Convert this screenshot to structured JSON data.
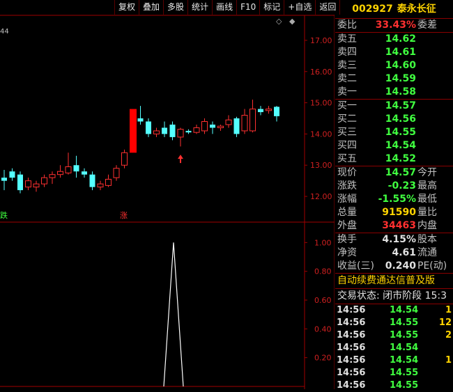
{
  "toolbar": [
    "复权",
    "叠加",
    "多股",
    "统计",
    "画线",
    "F10",
    "标记",
    "+自选",
    "返回"
  ],
  "chart": {
    "indicator_value": "44",
    "price_ticks": [
      "17.00",
      "16.00",
      "15.00",
      "14.00",
      "13.00",
      "12.00"
    ],
    "vol_ticks": [
      "1.00",
      "0.80",
      "0.60",
      "0.40",
      "0.20"
    ],
    "label_die": "跌",
    "label_zhang": "涨",
    "colors": {
      "up": "#ff3030",
      "down": "#54ffff",
      "limit_up": "#ff0000",
      "axis": "#a00000",
      "text": "#d02020"
    }
  },
  "chart_data": {
    "type": "candlestick",
    "price_range": [
      11.6,
      17.4
    ],
    "candles": [
      {
        "o": 12.6,
        "c": 12.5,
        "h": 12.85,
        "l": 12.2
      },
      {
        "o": 12.8,
        "c": 12.6,
        "h": 12.9,
        "l": 12.5
      },
      {
        "o": 12.7,
        "c": 12.2,
        "h": 12.8,
        "l": 12.1
      },
      {
        "o": 12.3,
        "c": 12.5,
        "h": 12.6,
        "l": 12.2
      },
      {
        "o": 12.3,
        "c": 12.4,
        "h": 12.5,
        "l": 12.15
      },
      {
        "o": 12.4,
        "c": 12.6,
        "h": 12.7,
        "l": 12.3
      },
      {
        "o": 12.6,
        "c": 12.7,
        "h": 12.8,
        "l": 12.4
      },
      {
        "o": 12.7,
        "c": 12.8,
        "h": 13.0,
        "l": 12.6
      },
      {
        "o": 12.75,
        "c": 12.95,
        "h": 13.4,
        "l": 12.7
      },
      {
        "o": 13.0,
        "c": 12.8,
        "h": 13.3,
        "l": 12.6
      },
      {
        "o": 12.8,
        "c": 12.7,
        "h": 12.9,
        "l": 12.6
      },
      {
        "o": 12.7,
        "c": 12.3,
        "h": 12.8,
        "l": 12.2
      },
      {
        "o": 12.3,
        "c": 12.4,
        "h": 12.5,
        "l": 12.2
      },
      {
        "o": 12.35,
        "c": 12.55,
        "h": 12.7,
        "l": 12.3
      },
      {
        "o": 12.6,
        "c": 12.9,
        "h": 13.0,
        "l": 12.5
      },
      {
        "o": 13.0,
        "c": 13.4,
        "h": 13.5,
        "l": 12.9
      },
      {
        "o": 13.4,
        "c": 14.8,
        "h": 14.8,
        "l": 13.4
      },
      {
        "o": 14.5,
        "c": 14.4,
        "h": 14.9,
        "l": 14.3
      },
      {
        "o": 14.4,
        "c": 14.0,
        "h": 14.5,
        "l": 13.9
      },
      {
        "o": 14.0,
        "c": 14.1,
        "h": 14.2,
        "l": 13.9
      },
      {
        "o": 14.2,
        "c": 14.0,
        "h": 14.4,
        "l": 13.9
      },
      {
        "o": 14.3,
        "c": 13.9,
        "h": 14.4,
        "l": 13.8
      },
      {
        "o": 13.9,
        "c": 14.15,
        "h": 14.2,
        "l": 13.6
      },
      {
        "o": 14.1,
        "c": 14.05,
        "h": 14.15,
        "l": 14.0
      },
      {
        "o": 14.05,
        "c": 14.2,
        "h": 14.3,
        "l": 14.0
      },
      {
        "o": 14.1,
        "c": 14.4,
        "h": 14.5,
        "l": 14.0
      },
      {
        "o": 14.3,
        "c": 14.2,
        "h": 14.4,
        "l": 14.0
      },
      {
        "o": 14.2,
        "c": 14.25,
        "h": 14.3,
        "l": 14.1
      },
      {
        "o": 14.3,
        "c": 14.45,
        "h": 14.6,
        "l": 14.2
      },
      {
        "o": 14.5,
        "c": 14.0,
        "h": 14.55,
        "l": 13.9
      },
      {
        "o": 14.1,
        "c": 14.6,
        "h": 14.8,
        "l": 14.0
      },
      {
        "o": 14.1,
        "c": 14.8,
        "h": 15.1,
        "l": 14.05
      },
      {
        "o": 14.8,
        "c": 14.7,
        "h": 14.9,
        "l": 14.6
      },
      {
        "o": 14.75,
        "c": 14.8,
        "h": 14.9,
        "l": 14.65
      },
      {
        "o": 14.87,
        "c": 14.57,
        "h": 14.9,
        "l": 14.4
      }
    ],
    "lower_indicator": {
      "range": [
        0,
        1.05
      ],
      "spike_value": 1.0
    }
  },
  "panel": {
    "code": "002927",
    "name": "泰永长征",
    "webi_label": "委比",
    "webi_value": "33.43%",
    "weicha_label": "委差",
    "sell": [
      {
        "label": "卖五",
        "price": "14.62"
      },
      {
        "label": "卖四",
        "price": "14.61"
      },
      {
        "label": "卖三",
        "price": "14.60"
      },
      {
        "label": "卖二",
        "price": "14.59"
      },
      {
        "label": "卖一",
        "price": "14.58"
      }
    ],
    "buy": [
      {
        "label": "买一",
        "price": "14.57"
      },
      {
        "label": "买二",
        "price": "14.56"
      },
      {
        "label": "买三",
        "price": "14.55"
      },
      {
        "label": "买四",
        "price": "14.54"
      },
      {
        "label": "买五",
        "price": "14.52"
      }
    ],
    "stats": [
      {
        "label": "现价",
        "value": "14.57",
        "color": "#40ff40",
        "label2": "今开"
      },
      {
        "label": "涨跌",
        "value": "-0.23",
        "color": "#40ff40",
        "label2": "最高"
      },
      {
        "label": "涨幅",
        "value": "-1.55%",
        "color": "#40ff40",
        "label2": "最低"
      },
      {
        "label": "总量",
        "value": "91590",
        "color": "#ffd400",
        "label2": "量比"
      },
      {
        "label": "外盘",
        "value": "34463",
        "color": "#ff3030",
        "label2": "内盘"
      }
    ],
    "stats2": [
      {
        "label": "换手",
        "value": "4.15%",
        "color": "#e0e0e0",
        "label2": "股本"
      },
      {
        "label": "净资",
        "value": "4.61",
        "color": "#e0e0e0",
        "label2": "流通"
      },
      {
        "label": "收益(三)",
        "value": "0.240",
        "color": "#e0e0e0",
        "label2": "PE(动)"
      }
    ],
    "notice": "自动续费通达信普及版",
    "state": "交易状态: 闭市阶段 15:3",
    "ticks": [
      {
        "time": "14:56",
        "price": "14.54",
        "vol": "1"
      },
      {
        "time": "14:56",
        "price": "14.55",
        "vol": "12"
      },
      {
        "time": "14:56",
        "price": "14.55",
        "vol": "2"
      },
      {
        "time": "14:56",
        "price": "14.54",
        "vol": ""
      },
      {
        "time": "14:56",
        "price": "14.54",
        "vol": "1"
      },
      {
        "time": "14:56",
        "price": "14.55",
        "vol": ""
      },
      {
        "time": "14:56",
        "price": "14.55",
        "vol": ""
      }
    ]
  }
}
